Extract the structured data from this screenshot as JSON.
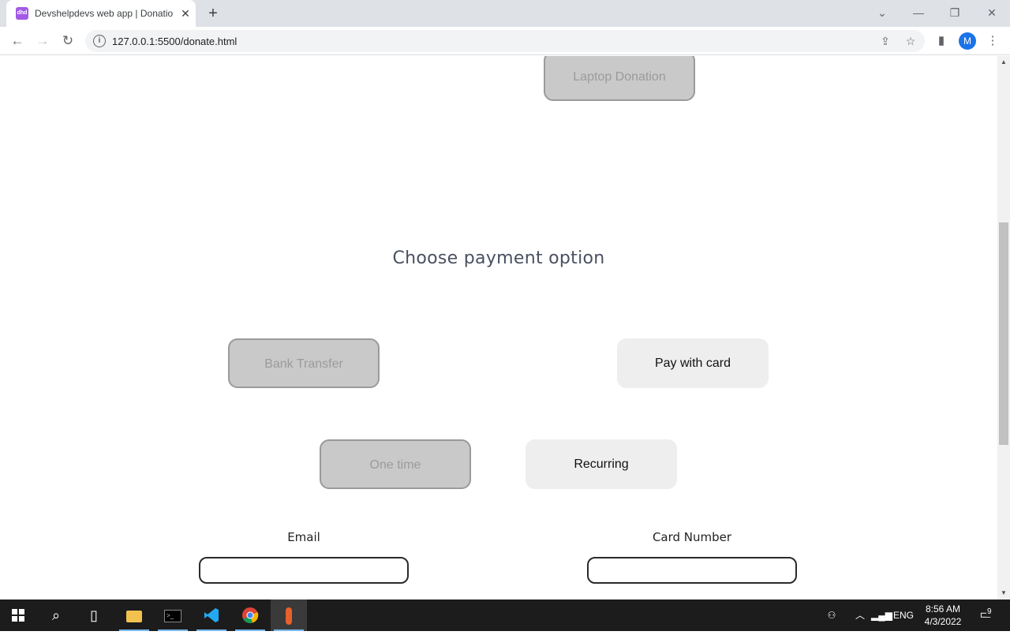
{
  "browser": {
    "tab_title": "Devshelpdevs web app | Donatio",
    "favicon_text": "dhd",
    "url": "127.0.0.1:5500/donate.html",
    "profile_initial": "M"
  },
  "page": {
    "laptop_donation_label": "Laptop Donation",
    "heading": "Choose payment option",
    "bank_transfer_label": "Bank Transfer",
    "pay_with_card_label": "Pay with card",
    "one_time_label": "One time",
    "recurring_label": "Recurring",
    "email_label": "Email",
    "email_value": "",
    "card_number_label": "Card Number",
    "card_number_value": "",
    "colors": {
      "selected": "#eeeeee",
      "unselected": "#c9c9c9",
      "heading": "#4a5060"
    }
  },
  "taskbar": {
    "language": "ENG",
    "time": "8:56 AM",
    "date": "4/3/2022",
    "notification_count": "9"
  }
}
